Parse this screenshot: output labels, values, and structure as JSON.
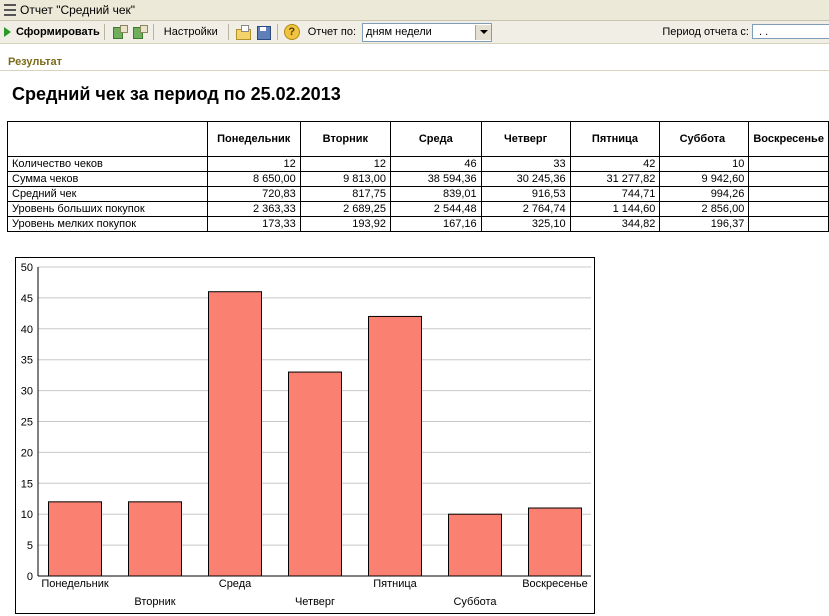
{
  "window": {
    "title": "Отчет \"Средний чек\""
  },
  "toolbar": {
    "run_label": "Сформировать",
    "settings_label": "Настройки",
    "report_by_label": "Отчет по:",
    "report_by_value": "дням недели",
    "period_label": "Период отчета с:",
    "period_value": ". ."
  },
  "result": {
    "section_label": "Результат",
    "title": "Средний чек за период по 25.02.2013"
  },
  "table": {
    "columns": [
      "Понедельник",
      "Вторник",
      "Среда",
      "Четверг",
      "Пятница",
      "Суббота",
      "Воскресенье"
    ],
    "rows": [
      {
        "label": "Количество чеков",
        "values": [
          "12",
          "12",
          "46",
          "33",
          "42",
          "10",
          ""
        ]
      },
      {
        "label": "Сумма чеков",
        "values": [
          "8 650,00",
          "9 813,00",
          "38 594,36",
          "30 245,36",
          "31 277,82",
          "9 942,60",
          ""
        ]
      },
      {
        "label": "Средний чек",
        "values": [
          "720,83",
          "817,75",
          "839,01",
          "916,53",
          "744,71",
          "994,26",
          ""
        ]
      },
      {
        "label": "Уровень больших покупок",
        "values": [
          "2 363,33",
          "2 689,25",
          "2 544,48",
          "2 764,74",
          "1 144,60",
          "2 856,00",
          ""
        ]
      },
      {
        "label": "Уровень мелких покупок",
        "values": [
          "173,33",
          "193,92",
          "167,16",
          "325,10",
          "344,82",
          "196,37",
          ""
        ]
      }
    ]
  },
  "chart_data": {
    "type": "bar",
    "categories": [
      "Понедельник",
      "Вторник",
      "Среда",
      "Четверг",
      "Пятница",
      "Суббота",
      "Воскресенье"
    ],
    "values": [
      12,
      12,
      46,
      33,
      42,
      10,
      11
    ],
    "ylim": [
      0,
      50
    ],
    "yticks": [
      0,
      5,
      10,
      15,
      20,
      25,
      30,
      35,
      40,
      45,
      50
    ],
    "grid": true,
    "bar_color": "#fa8072",
    "title": "",
    "xlabel": "",
    "ylabel": ""
  },
  "colors": {
    "section_label": "#7a6a1a",
    "run_icon": "#2a9a2a",
    "bar": "#fa8072"
  },
  "icons": [
    "play-icon",
    "generate-icon",
    "refresh-icon",
    "open-icon",
    "save-icon",
    "help-icon",
    "dropdown-arrow-icon"
  ]
}
